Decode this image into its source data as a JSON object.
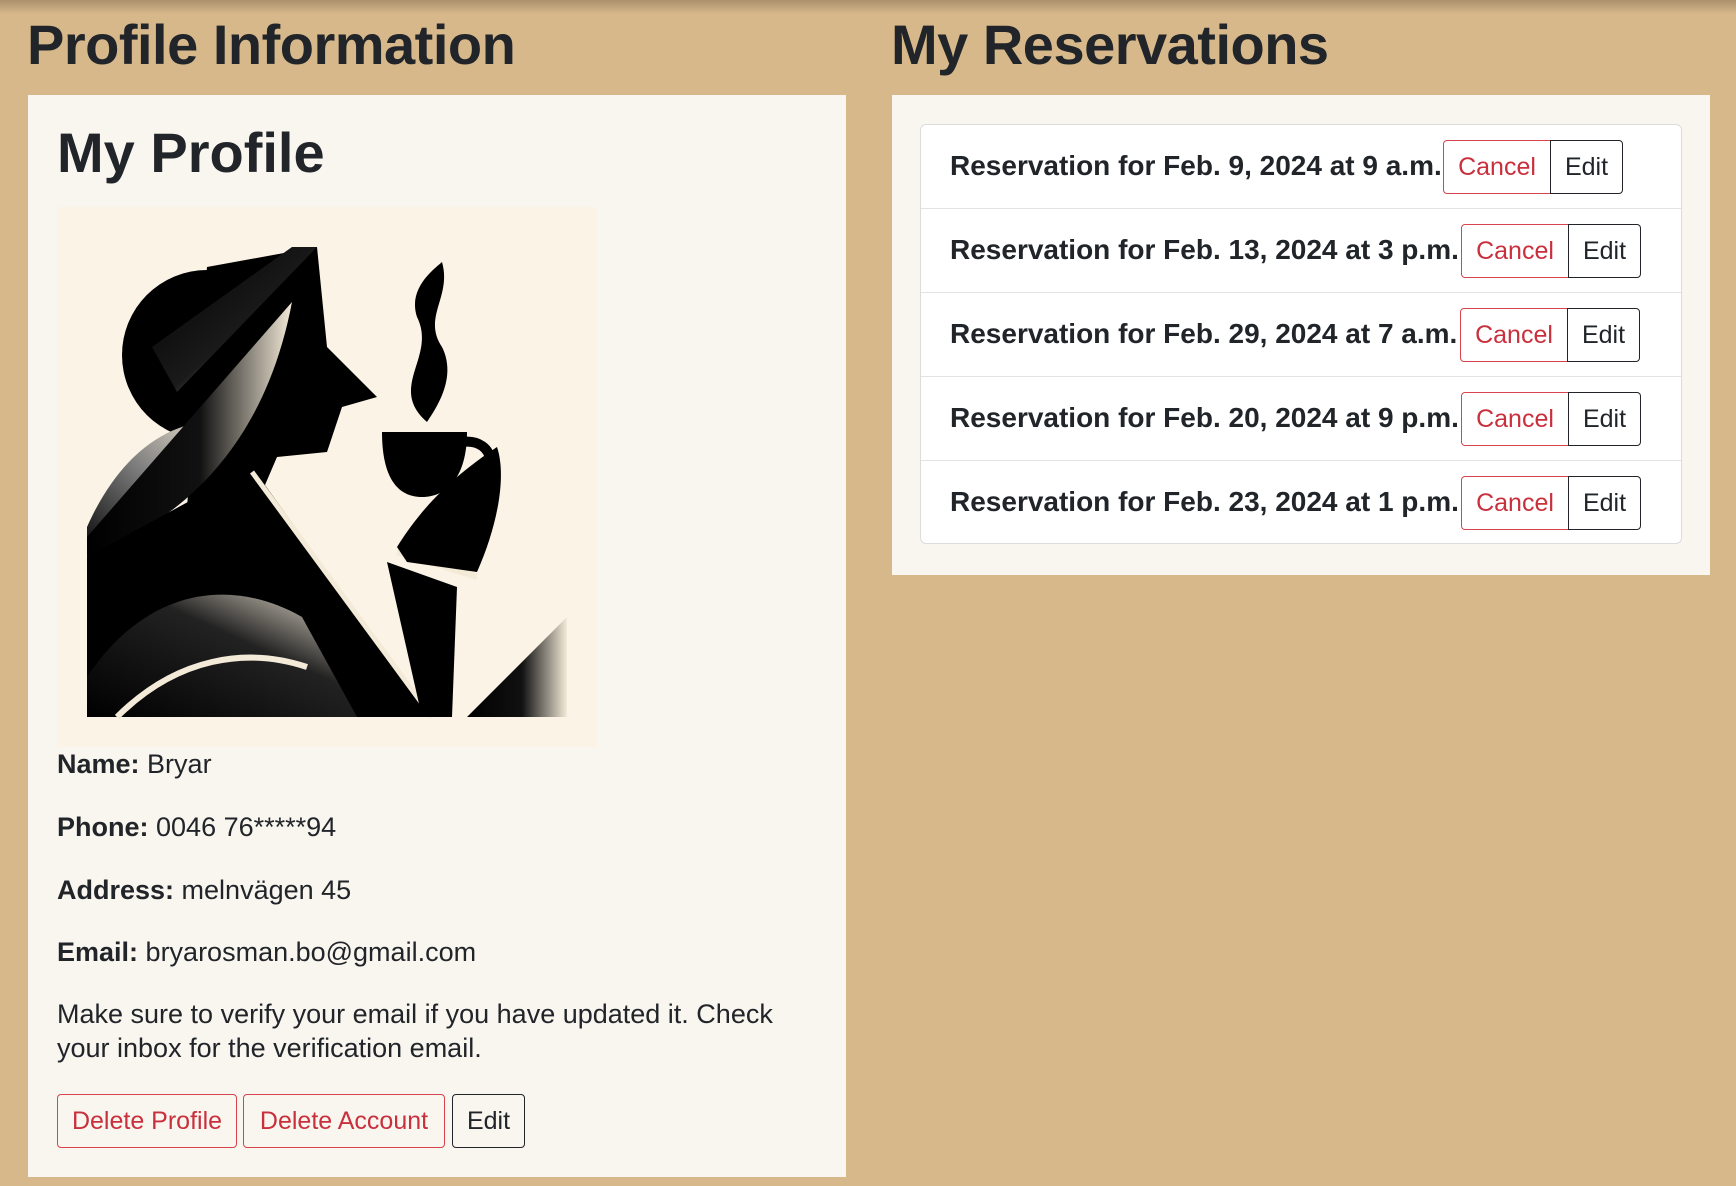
{
  "sections": {
    "profile_title": "Profile Information",
    "reservations_title": "My Reservations"
  },
  "profile": {
    "card_title": "My Profile",
    "avatar_icon": "person-drinking-coffee-illustration",
    "name_label": "Name:",
    "name_value": "Bryar",
    "phone_label": "Phone:",
    "phone_value": "0046 76*****94",
    "address_label": "Address:",
    "address_value": "melnvägen 45",
    "email_label": "Email:",
    "email_value": "bryarosman.bo@gmail.com",
    "verify_note": "Make sure to verify your email if you have updated it. Check your inbox for the verification email.",
    "buttons": {
      "delete_profile": "Delete Profile",
      "delete_account": "Delete Account",
      "edit": "Edit"
    }
  },
  "reservations": [
    {
      "label": "Reservation for Feb. 9, 2024 at 9 a.m.",
      "cancel": "Cancel",
      "edit": "Edit"
    },
    {
      "label": "Reservation for Feb. 13, 2024 at 3 p.m.",
      "cancel": "Cancel",
      "edit": "Edit"
    },
    {
      "label": "Reservation for Feb. 29, 2024 at 7 a.m.",
      "cancel": "Cancel",
      "edit": "Edit"
    },
    {
      "label": "Reservation for Feb. 20, 2024 at 9 p.m.",
      "cancel": "Cancel",
      "edit": "Edit"
    },
    {
      "label": "Reservation for Feb. 23, 2024 at 1 p.m.",
      "cancel": "Cancel",
      "edit": "Edit"
    }
  ],
  "colors": {
    "page_background": "#d7b88b",
    "panel_background": "#f9f5ef",
    "danger": "#c9303d",
    "text": "#212529"
  }
}
